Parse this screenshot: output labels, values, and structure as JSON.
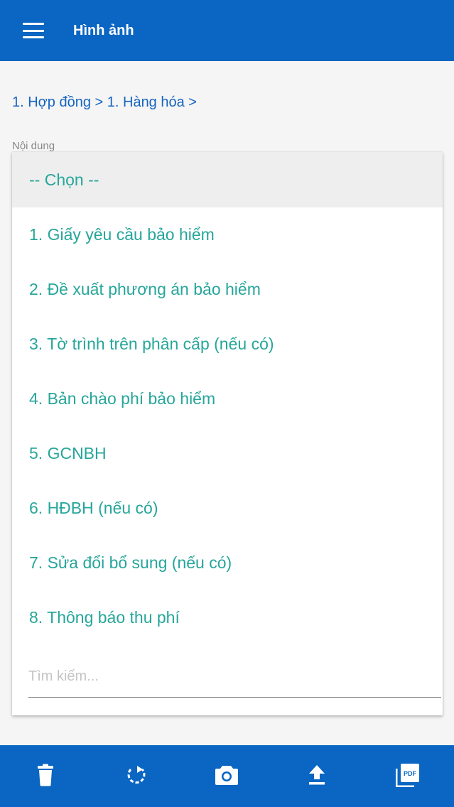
{
  "app_bar": {
    "title": "Hình ảnh",
    "menu_icon": "hamburger-menu-icon",
    "color": "#0a66c2"
  },
  "breadcrumb": "1. Hợp đồng > 1. Hàng hóa >",
  "field": {
    "label": "Nội dung"
  },
  "dropdown": {
    "selected_label": "-- Chọn --",
    "options": [
      "1. Giấy yêu cầu bảo hiểm",
      "2. Đề xuất phương án bảo hiểm",
      "3. Tờ trình trên phân cấp (nếu có)",
      "4. Bản chào phí bảo hiểm",
      "5. GCNBH",
      "6. HĐBH (nếu có)",
      "7. Sửa đổi bổ sung (nếu có)",
      "8. Thông báo thu phí"
    ],
    "search_placeholder": "Tìm kiếm...",
    "option_color": "#26a69a"
  },
  "bottom_bar": {
    "icons": [
      "delete-icon",
      "rotate-icon",
      "camera-icon",
      "upload-icon",
      "pdf-icon"
    ],
    "color": "#0a66c2"
  }
}
